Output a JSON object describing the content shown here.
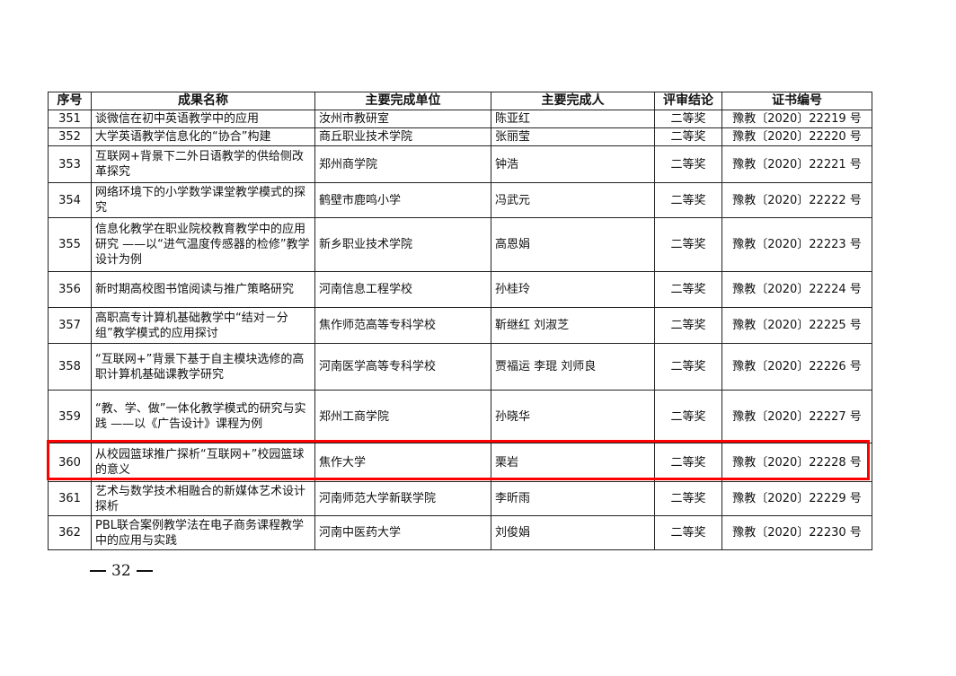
{
  "table": {
    "headers": [
      "序号",
      "成果名称",
      "主要完成单位",
      "主要完成人",
      "评审结论",
      "证书编号"
    ],
    "rows": [
      {
        "no": "351",
        "name": "谈微信在初中英语教学中的应用",
        "unit": "汝州市教研室",
        "person": "陈亚红",
        "level": "二等奖",
        "cert": "豫教〔2020〕22219 号"
      },
      {
        "no": "352",
        "name": "大学英语教学信息化的“协合”构建",
        "unit": "商丘职业技术学院",
        "person": "张丽莹",
        "level": "二等奖",
        "cert": "豫教〔2020〕22220 号"
      },
      {
        "no": "353",
        "name": "互联网+背景下二外日语教学的供给侧改革探究",
        "unit": "郑州商学院",
        "person": "钟浩",
        "level": "二等奖",
        "cert": "豫教〔2020〕22221 号"
      },
      {
        "no": "354",
        "name": "网络环境下的小学数学课堂教学模式的探究",
        "unit": "鹤壁市鹿鸣小学",
        "person": "冯武元",
        "level": "二等奖",
        "cert": "豫教〔2020〕22222 号"
      },
      {
        "no": "355",
        "name": "信息化教学在职业院校教育教学中的应用研究 ——以“进气温度传感器的检修”教学设计为例",
        "unit": "新乡职业技术学院",
        "person": "高恩娟",
        "level": "二等奖",
        "cert": "豫教〔2020〕22223 号"
      },
      {
        "no": "356",
        "name": "新时期高校图书馆阅读与推广策略研究",
        "unit": "河南信息工程学校",
        "person": "孙桂玲",
        "level": "二等奖",
        "cert": "豫教〔2020〕22224 号"
      },
      {
        "no": "357",
        "name": "高职高专计算机基础教学中“结对－分组”教学模式的应用探讨",
        "unit": "焦作师范高等专科学校",
        "person": "靳继红 刘淑芝",
        "level": "二等奖",
        "cert": "豫教〔2020〕22225 号"
      },
      {
        "no": "358",
        "name": "“互联网+”背景下基于自主模块选修的高职计算机基础课教学研究",
        "unit": "河南医学高等专科学校",
        "person": "贾福运 李琨 刘师良",
        "level": "二等奖",
        "cert": "豫教〔2020〕22226 号"
      },
      {
        "no": "359",
        "name": "“教、学、做”一体化教学模式的研究与实践 ——以《广告设计》课程为例",
        "unit": "郑州工商学院",
        "person": "孙晓华",
        "level": "二等奖",
        "cert": "豫教〔2020〕22227 号"
      },
      {
        "no": "360",
        "name": "从校园篮球推广探析“互联网+”校园篮球的意义",
        "unit": "焦作大学",
        "person": "栗岩",
        "level": "二等奖",
        "cert": "豫教〔2020〕22228 号"
      },
      {
        "no": "361",
        "name": "艺术与数学技术相融合的新媒体艺术设计探析",
        "unit": "河南师范大学新联学院",
        "person": "李昕雨",
        "level": "二等奖",
        "cert": "豫教〔2020〕22229 号"
      },
      {
        "no": "362",
        "name": "PBL联合案例教学法在电子商务课程教学中的应用与实践",
        "unit": "河南中医药大学",
        "person": "刘俊娟",
        "level": "二等奖",
        "cert": "豫教〔2020〕22230 号"
      }
    ]
  },
  "footer": {
    "page_number": "32"
  },
  "highlight_color": "#ff0000"
}
